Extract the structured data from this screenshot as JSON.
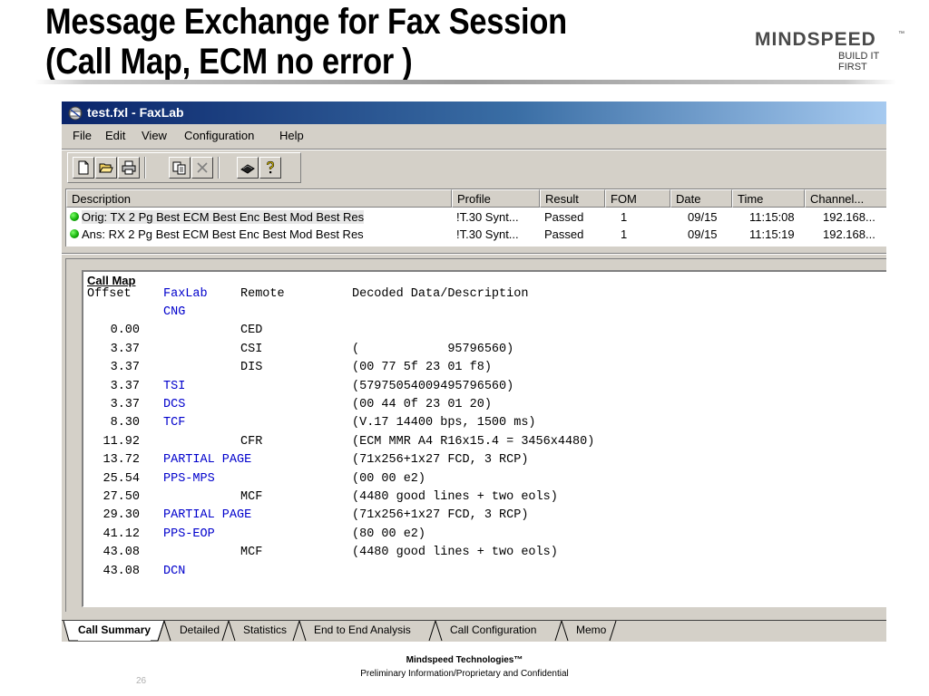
{
  "slide": {
    "title_line1": "Message Exchange for Fax Session",
    "title_line2": "(Call Map, ECM no error )",
    "logo_text": "MINDSPEED",
    "logo_tm": "™",
    "logo_tagline": "BUILD IT FIRST",
    "footer_company": "Mindspeed Technologies™",
    "footer_confidential": "Preliminary Information/Proprietary and Confidential",
    "page_number": "26"
  },
  "window": {
    "title": "test.fxl - FaxLab",
    "colors": {
      "titlebar_start": "#0a246a",
      "titlebar_end": "#a6caf0",
      "face": "#d4d0c8"
    }
  },
  "menu": [
    "File",
    "Edit",
    "View",
    "Configuration",
    "Help"
  ],
  "toolbar": {
    "buttons": [
      "new-icon",
      "open-icon",
      "print-icon",
      "copy-icon",
      "delete-icon",
      "compile-icon",
      "help-icon"
    ]
  },
  "sessions": {
    "columns": [
      "Description",
      "Profile",
      "Result",
      "FOM",
      "Date",
      "Time",
      "Channel..."
    ],
    "rows": [
      {
        "description": "Orig: TX 2 Pg Best ECM Best Enc Best Mod Best Res",
        "profile": "!T.30 Synt...",
        "result": "Passed",
        "fom": "1",
        "date": "09/15",
        "time": "11:15:08",
        "channel": "192.168...",
        "status_color": "#15b10b"
      },
      {
        "description": "Ans: RX 2 Pg Best ECM Best Enc Best Mod Best Res",
        "profile": "!T.30 Synt...",
        "result": "Passed",
        "fom": "1",
        "date": "09/15",
        "time": "11:15:19",
        "channel": "192.168...",
        "status_color": "#15b10b"
      }
    ]
  },
  "call_map": {
    "heading": "Call Map",
    "columns": [
      "Offset",
      "FaxLab",
      "Remote",
      "Decoded Data/Description"
    ],
    "rows": [
      {
        "offset": "",
        "faxlab": "CNG",
        "remote": "",
        "desc": ""
      },
      {
        "offset": "0.00",
        "faxlab": "",
        "remote": "CED",
        "desc": ""
      },
      {
        "offset": "3.37",
        "faxlab": "",
        "remote": "CSI",
        "desc": "(            95796560)"
      },
      {
        "offset": "3.37",
        "faxlab": "",
        "remote": "DIS",
        "desc": "(00 77 5f 23 01 f8)"
      },
      {
        "offset": "3.37",
        "faxlab": "TSI",
        "remote": "",
        "desc": "(57975054009495796560)"
      },
      {
        "offset": "3.37",
        "faxlab": "DCS",
        "remote": "",
        "desc": "(00 44 0f 23 01 20)"
      },
      {
        "offset": "8.30",
        "faxlab": "TCF",
        "remote": "",
        "desc": "(V.17 14400 bps, 1500 ms)"
      },
      {
        "offset": "11.92",
        "faxlab": "",
        "remote": "CFR",
        "desc": "(ECM MMR A4 R16x15.4 = 3456x4480)"
      },
      {
        "offset": "13.72",
        "faxlab": "PARTIAL PAGE",
        "remote": "",
        "desc": "(71x256+1x27 FCD, 3 RCP)"
      },
      {
        "offset": "25.54",
        "faxlab": "PPS-MPS",
        "remote": "",
        "desc": "(00 00 e2)"
      },
      {
        "offset": "27.50",
        "faxlab": "",
        "remote": "MCF",
        "desc": "(4480 good lines + two eols)"
      },
      {
        "offset": "29.30",
        "faxlab": "PARTIAL PAGE",
        "remote": "",
        "desc": "(71x256+1x27 FCD, 3 RCP)"
      },
      {
        "offset": "41.12",
        "faxlab": "PPS-EOP",
        "remote": "",
        "desc": "(80 00 e2)"
      },
      {
        "offset": "43.08",
        "faxlab": "",
        "remote": "MCF",
        "desc": "(4480 good lines + two eols)"
      },
      {
        "offset": "43.08",
        "faxlab": "DCN",
        "remote": "",
        "desc": ""
      }
    ]
  },
  "tabs": [
    "Call Summary",
    "Detailed",
    "Statistics",
    "End to End Analysis",
    "Call Configuration",
    "Memo"
  ],
  "active_tab": "Call Summary"
}
